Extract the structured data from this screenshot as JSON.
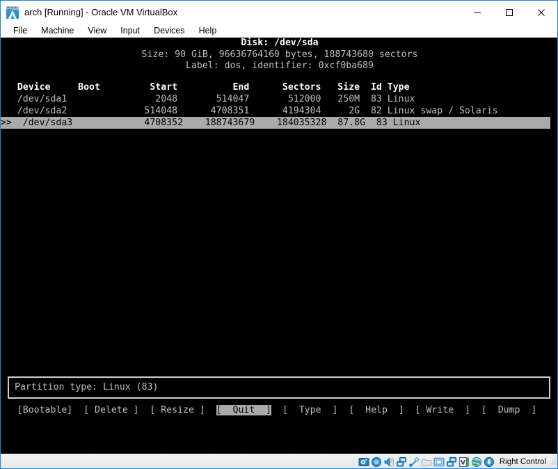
{
  "window": {
    "title": "arch [Running] - Oracle VM VirtualBox",
    "icon": "virtualbox-vm-icon",
    "controls": {
      "minimize": "minimize-icon",
      "maximize": "maximize-icon",
      "close": "close-icon"
    }
  },
  "menubar": {
    "items": [
      {
        "label": "File"
      },
      {
        "label": "Machine"
      },
      {
        "label": "View"
      },
      {
        "label": "Input"
      },
      {
        "label": "Devices"
      },
      {
        "label": "Help"
      }
    ]
  },
  "terminal": {
    "disk_title": "Disk: /dev/sda",
    "size_line": "Size: 90 GiB, 96636764160 bytes, 188743680 sectors",
    "label_line": "Label: dos, identifier: 0xcf0ba689",
    "header": "   Device     Boot         Start          End      Sectors   Size  Id Type",
    "rows": [
      {
        "marker": "  ",
        "text": "   /dev/sda1                2048       514047       512000   250M  83 Linux",
        "device": "/dev/sda1",
        "boot": "",
        "start": "2048",
        "end": "514047",
        "sectors": "512000",
        "size": "250M",
        "id": "83",
        "type": "Linux",
        "selected": false
      },
      {
        "marker": "  ",
        "text": "   /dev/sda2              514048      4708351      4194304     2G  82 Linux swap / Solaris",
        "device": "/dev/sda2",
        "boot": "",
        "start": "514048",
        "end": "4708351",
        "sectors": "4194304",
        "size": "2G",
        "id": "82",
        "type": "Linux swap / Solaris",
        "selected": false
      },
      {
        "marker": ">>",
        "text": ">>  /dev/sda3             4708352    188743679    184035328  87.8G  83 Linux",
        "device": "/dev/sda3",
        "boot": "",
        "start": "4708352",
        "end": "188743679",
        "sectors": "184035328",
        "size": "87.8G",
        "id": "83",
        "type": "Linux",
        "selected": true
      }
    ],
    "columns": [
      "Device",
      "Boot",
      "Start",
      "End",
      "Sectors",
      "Size",
      "Id",
      "Type"
    ],
    "partition_type_box": "Partition type: Linux (83)",
    "buttons": [
      {
        "label": "[Bootable]",
        "selected": false
      },
      {
        "label": "[ Delete ]",
        "selected": false
      },
      {
        "label": "[ Resize ]",
        "selected": false
      },
      {
        "label": "[  Quit  ]",
        "selected": true
      },
      {
        "label": "[  Type  ]",
        "selected": false
      },
      {
        "label": "[  Help  ]",
        "selected": false
      },
      {
        "label": "[ Write  ]",
        "selected": false
      },
      {
        "label": "[  Dump  ]",
        "selected": false
      }
    ],
    "buttons_gap": "  ",
    "buttons_indent": "   ",
    "colors": {
      "background": "#000000",
      "foreground": "#bfbfbf",
      "bright": "#ffffff",
      "selection_bg": "#aaaaaa",
      "selection_fg": "#000000"
    }
  },
  "statusbar": {
    "icons": [
      "hard-disk-icon",
      "optical-disk-icon",
      "audio-icon",
      "network-icon",
      "usb-icon",
      "shared-folder-icon",
      "display-icon",
      "remote-display-icon",
      "video-capture-icon",
      "globe-icon",
      "mouse-integration-icon"
    ],
    "host_key": "Right Control",
    "resize_grip": "resize-grip-icon"
  }
}
